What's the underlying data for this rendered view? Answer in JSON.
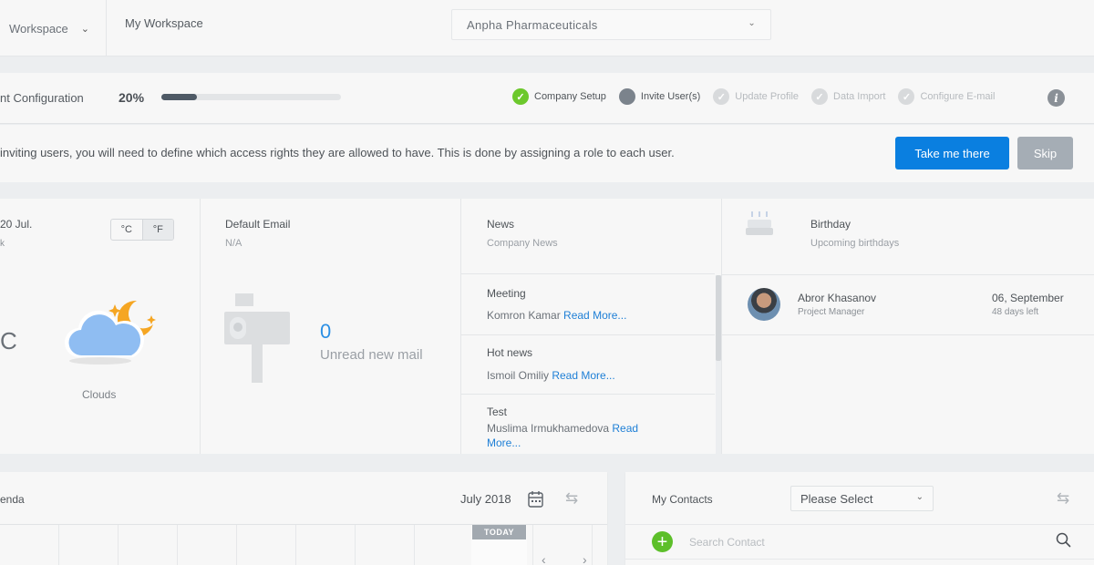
{
  "topbar": {
    "workspace_dropdown": "Workspace",
    "my_workspace": "My Workspace",
    "company": "Anpha Pharmaceuticals"
  },
  "config": {
    "title": "nt Configuration",
    "percent_label": "20%",
    "progress": 0.2,
    "steps": [
      {
        "label": "Company Setup",
        "state": "done"
      },
      {
        "label": "Invite User(s)",
        "state": "current"
      },
      {
        "label": "Update Profile",
        "state": "todo"
      },
      {
        "label": "Data Import",
        "state": "todo"
      },
      {
        "label": "Configure E-mail",
        "state": "todo"
      }
    ],
    "info_icon": "i"
  },
  "message": {
    "text": "inviting users, you will need to define which access rights they are allowed to have. This is done by assigning a role to each user.",
    "primary_button": "Take me there",
    "skip_button": "Skip"
  },
  "weather": {
    "date": "20 Jul.",
    "sub": "k",
    "unit_c": "°C",
    "unit_f": "°F",
    "temp": "C",
    "condition": "Clouds"
  },
  "email": {
    "title": "Default Email",
    "address": "N/A",
    "count": "0",
    "label": "Unread new mail"
  },
  "news": {
    "title": "News",
    "subtitle": "Company News",
    "read_more": "Read More...",
    "items": [
      {
        "title": "Meeting",
        "author": "Komron Kamar"
      },
      {
        "title": "Hot news",
        "author": "Ismoil Omiliy"
      },
      {
        "title": "Test",
        "author": "Muslima Irmukhamedova"
      }
    ]
  },
  "birthday": {
    "title": "Birthday",
    "subtitle": "Upcoming birthdays",
    "person": {
      "name": "Abror Khasanov",
      "role": "Project Manager",
      "date": "06, September",
      "days_left": "48 days left"
    }
  },
  "agenda": {
    "title": "enda",
    "month": "July 2018",
    "today": "TODAY"
  },
  "contacts": {
    "title": "My Contacts",
    "select_value": "Please Select",
    "search_placeholder": "Search Contact"
  },
  "colors": {
    "primary": "#0a7fe0",
    "done": "#6cc82c",
    "progress_fill": "#4f5a66",
    "link": "#1e7fd6"
  }
}
